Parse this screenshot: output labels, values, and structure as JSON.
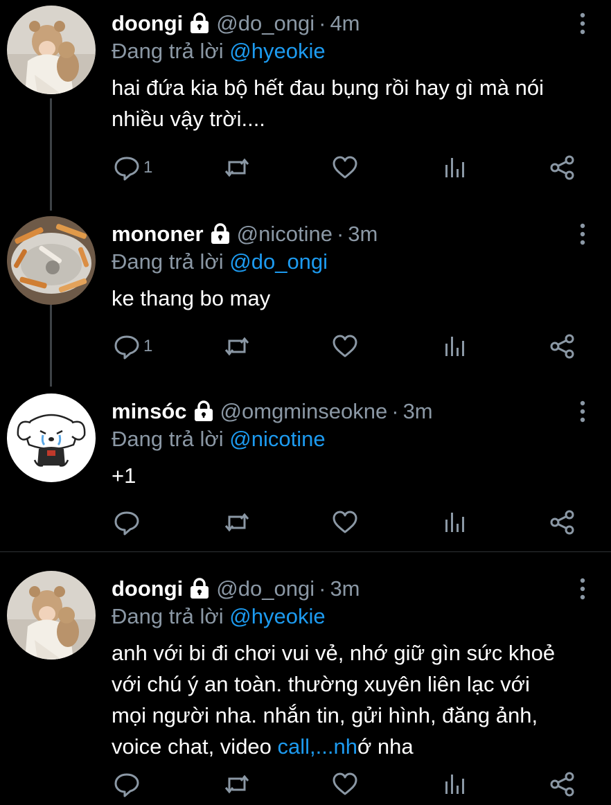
{
  "reply_prefix": "Đang trả lời",
  "colors": {
    "background": "#000000",
    "muted": "#8b98a5",
    "link": "#1d9bf0"
  },
  "tweets": [
    {
      "name": "doongi",
      "handle": "@do_ongi",
      "time": "4m",
      "reply_to": "@hyeokie",
      "text": "hai đứa kia bộ hết đau bụng rồi hay gì mà nói nhiều vậy trời....",
      "reply_count": "1",
      "avatar": "avatar-bear-hat-photo"
    },
    {
      "name": "mononer",
      "handle": "@nicotine",
      "time": "3m",
      "reply_to": "@do_ongi",
      "text": "ke thang bo may",
      "reply_count": "1",
      "avatar": "avatar-ashtray-photo"
    },
    {
      "name": "minsóc",
      "handle": "@omgminseokne",
      "time": "3m",
      "reply_to": "@nicotine",
      "text": "+1",
      "reply_count": "",
      "avatar": "avatar-crying-puppy-drawing"
    },
    {
      "name": "doongi",
      "handle": "@do_ongi",
      "time": "3m",
      "reply_to": "@hyeokie",
      "text_main": "anh với bi đi chơi vui vẻ, nhớ giữ gìn sức khoẻ với chú ý an toàn. thường xuyên liên lạc với mọi người nha. nhắn tin, gửi hình, đăng ảnh, voice chat, video ",
      "text_link": "call,...nh",
      "text_tail": "ớ nha",
      "reply_count": "",
      "avatar": "avatar-bear-hat-photo"
    }
  ]
}
